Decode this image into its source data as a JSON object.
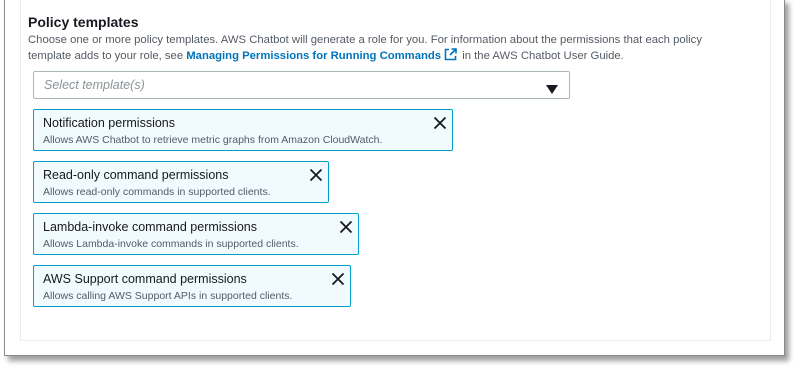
{
  "section": {
    "title": "Policy templates",
    "description_before": "Choose one or more policy templates. AWS Chatbot will generate a role for you. For information about the permissions that each policy template adds to your role, see ",
    "link_text": "Managing Permissions for Running Commands",
    "description_after": " in the AWS Chatbot User Guide."
  },
  "select": {
    "placeholder": "Select template(s)"
  },
  "tokens": [
    {
      "name": "Notification permissions",
      "description": "Allows AWS Chatbot to retrieve metric graphs from Amazon CloudWatch."
    },
    {
      "name": "Read-only command permissions",
      "description": "Allows read-only commands in supported clients."
    },
    {
      "name": "Lambda-invoke command permissions",
      "description": "Allows Lambda-invoke commands in supported clients."
    },
    {
      "name": "AWS Support command permissions",
      "description": "Allows calling AWS Support APIs in supported clients."
    }
  ],
  "colors": {
    "link": "#0073bb",
    "token_border": "#00a1c9",
    "token_bg": "#f1faff"
  },
  "icons": {
    "external_link": "external-link-icon",
    "dropdown": "caret-down-icon",
    "remove": "close-icon"
  }
}
